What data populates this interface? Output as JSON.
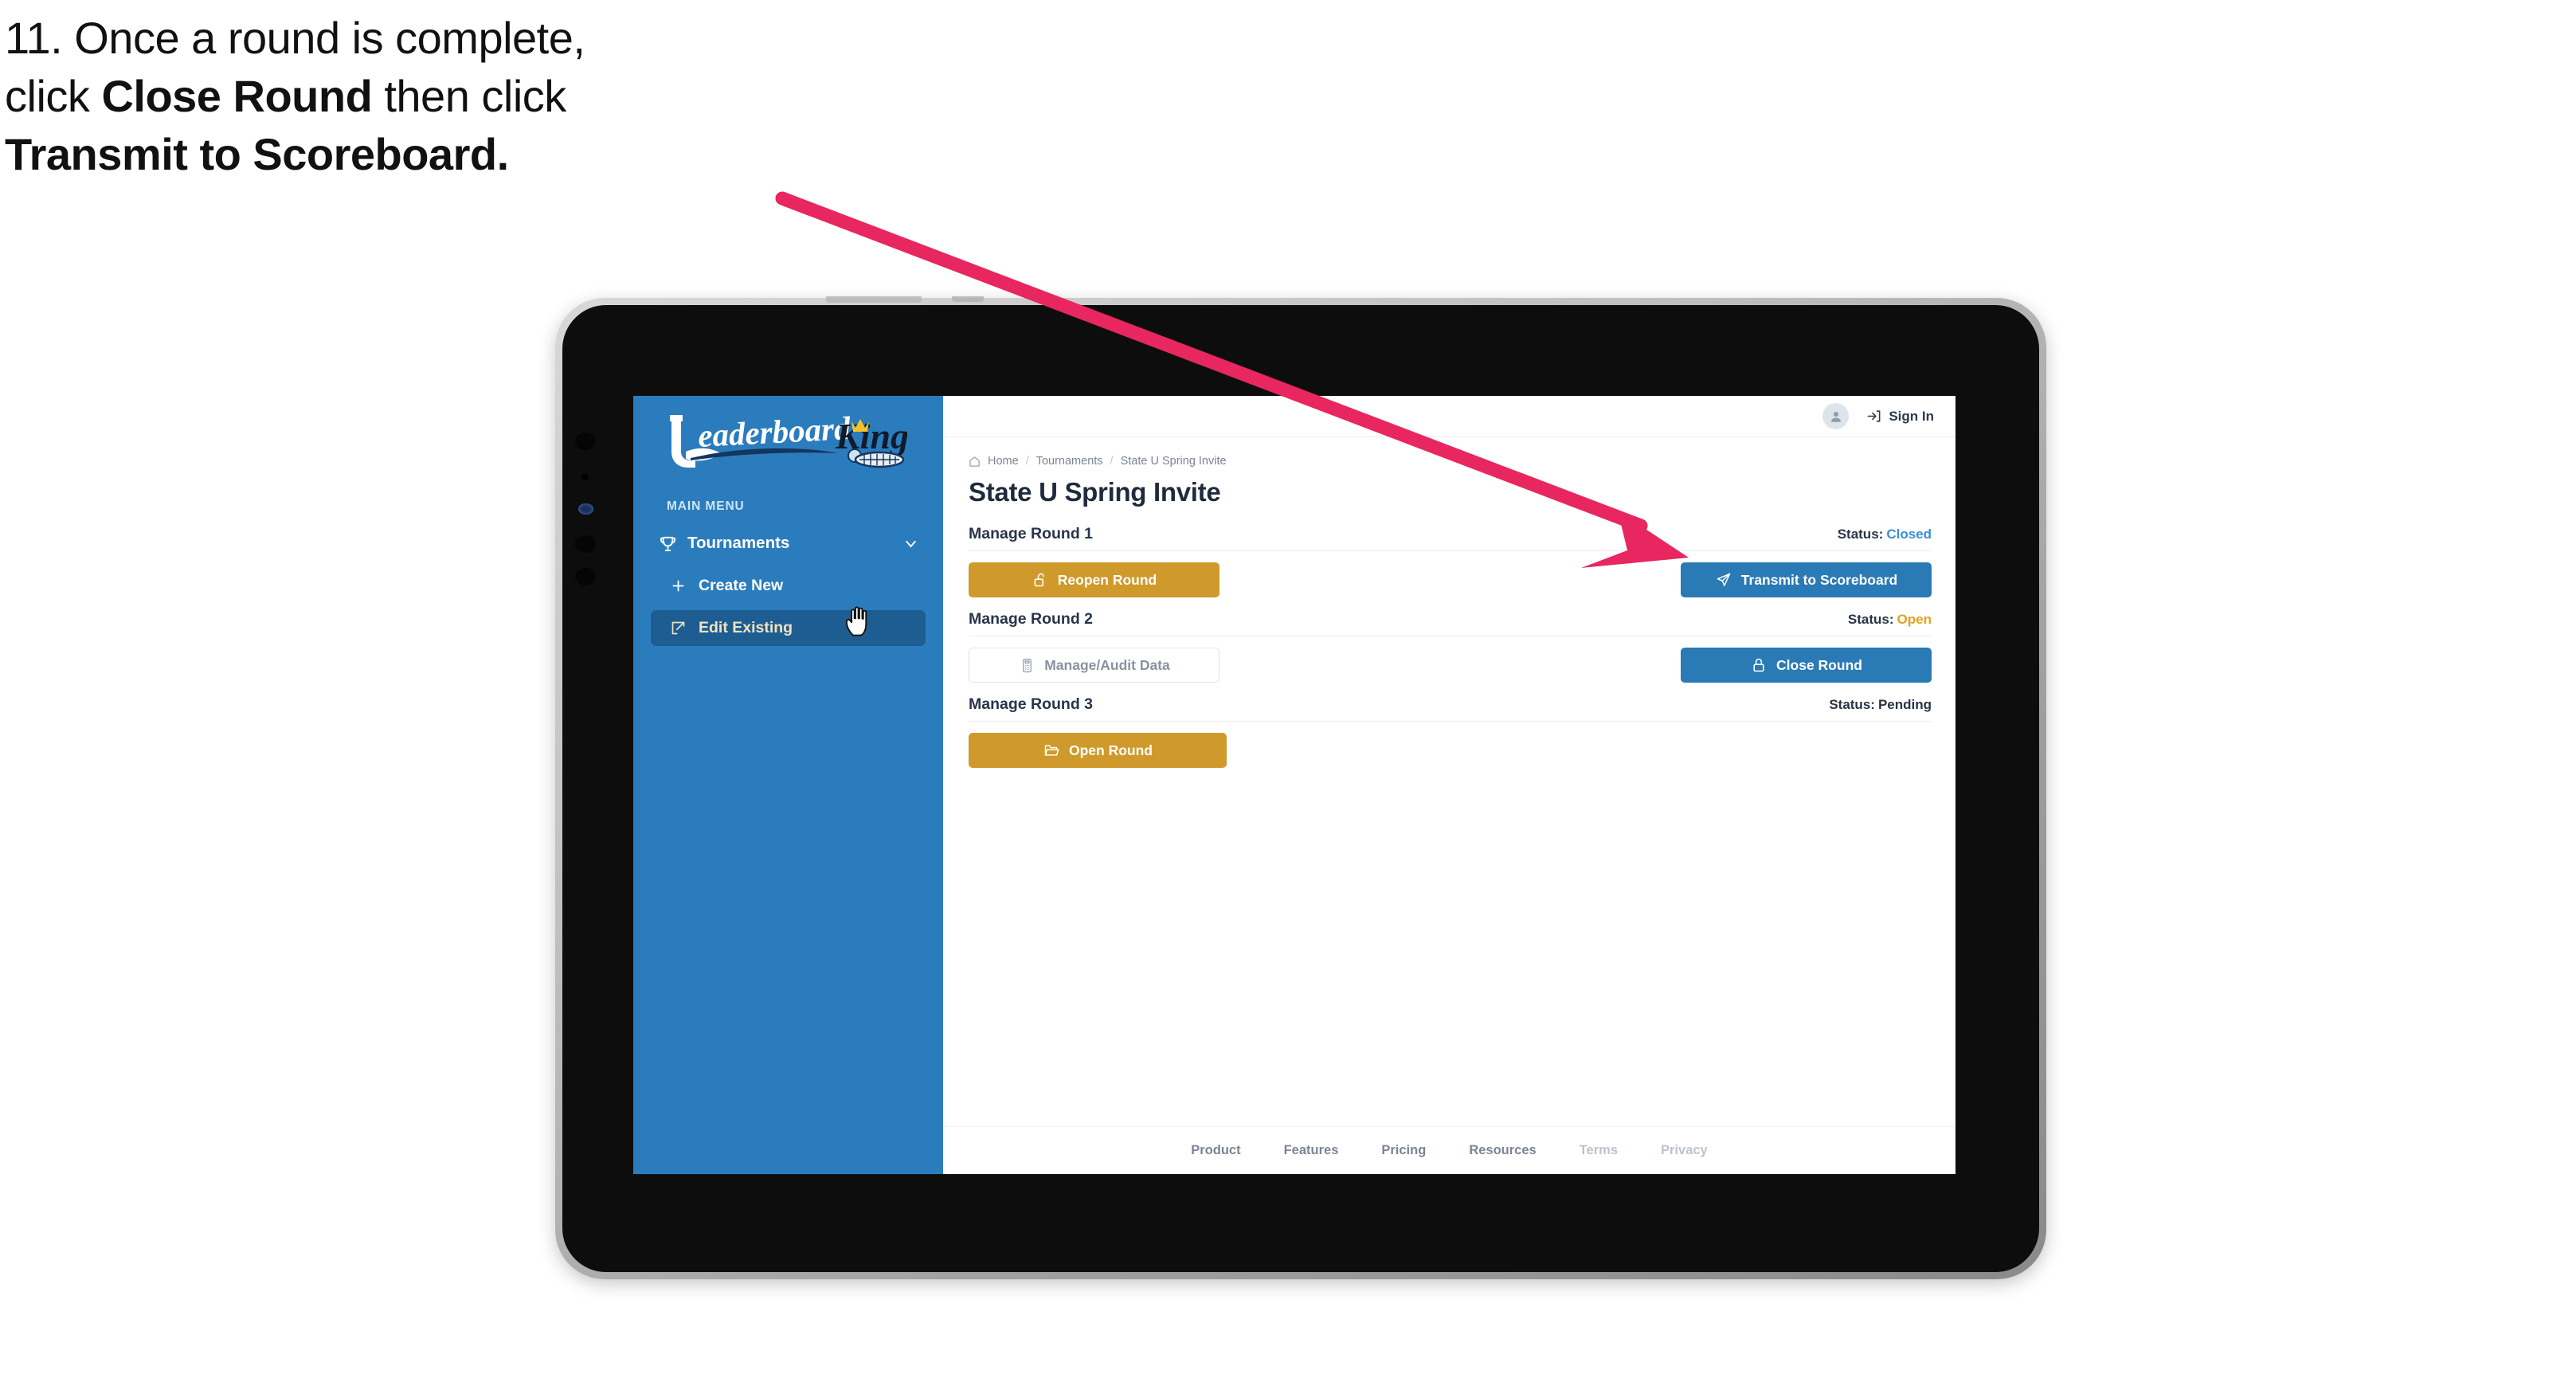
{
  "caption": {
    "line1": "11. Once a round is complete,",
    "line2_a": "click ",
    "line2_b": "Close Round",
    "line2_c": " then click",
    "line3": "Transmit to Scoreboard."
  },
  "colors": {
    "sidebar_blue": "#2B7CBD",
    "sidebar_active": "#1D5D92",
    "accent_gold": "#CF9A2B",
    "accent_blue": "#2A7AB6",
    "status_open": "#E0A21F",
    "status_closed": "#3B8FD6",
    "arrow_pink": "#E8265F"
  },
  "sidebar": {
    "logo_primary": "Leaderboard",
    "logo_secondary": "King",
    "section_label": "MAIN MENU",
    "items": [
      {
        "label": "Tournaments",
        "icon": "trophy-icon",
        "chevron": "chevron-down-icon",
        "active": false
      },
      {
        "label": "Create New",
        "icon": "plus-icon",
        "active": false
      },
      {
        "label": "Edit Existing",
        "icon": "edit-square-icon",
        "active": true
      }
    ]
  },
  "topbar": {
    "avatar_icon": "user-avatar-icon",
    "signin_icon": "sign-in-icon",
    "signin_label": "Sign In"
  },
  "breadcrumb": {
    "home_icon": "home-icon",
    "items": [
      "Home",
      "Tournaments",
      "State U Spring Invite"
    ],
    "separator": "/"
  },
  "page": {
    "title": "State U Spring Invite"
  },
  "rounds": [
    {
      "title": "Manage Round 1",
      "status_label": "Status:",
      "status_value": "Closed",
      "status_kind": "closed",
      "left_button": {
        "label": "Reopen Round",
        "icon": "unlock-icon",
        "style": "gold"
      },
      "right_button": {
        "label": "Transmit to Scoreboard",
        "icon": "paper-plane-icon",
        "style": "blue"
      }
    },
    {
      "title": "Manage Round 2",
      "status_label": "Status:",
      "status_value": "Open",
      "status_kind": "open",
      "left_button": {
        "label": "Manage/Audit Data",
        "icon": "calculator-icon",
        "style": "ghost"
      },
      "right_button": {
        "label": "Close Round",
        "icon": "lock-icon",
        "style": "blue"
      }
    },
    {
      "title": "Manage Round 3",
      "status_label": "Status:",
      "status_value": "Pending",
      "status_kind": "pending",
      "left_button": {
        "label": "Open Round",
        "icon": "open-folder-icon",
        "style": "gold"
      },
      "right_button": null
    }
  ],
  "footer": {
    "links": [
      {
        "label": "Product",
        "dim": false
      },
      {
        "label": "Features",
        "dim": false
      },
      {
        "label": "Pricing",
        "dim": false
      },
      {
        "label": "Resources",
        "dim": false
      },
      {
        "label": "Terms",
        "dim": true
      },
      {
        "label": "Privacy",
        "dim": true
      }
    ]
  },
  "annotation": {
    "arrow_name": "callout-arrow",
    "cursor_name": "hand-cursor"
  }
}
